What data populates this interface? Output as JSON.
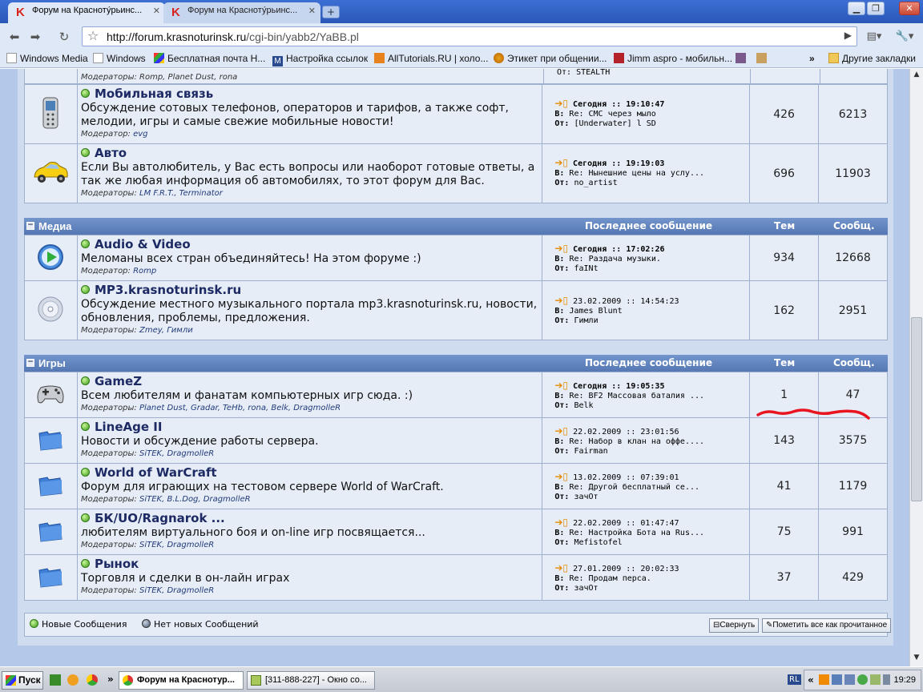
{
  "browser": {
    "tabs": [
      {
        "label": "Форум на Красноту́рьинс...",
        "active": true
      },
      {
        "label": "Форум на Красноту́рьинс...",
        "active": false
      }
    ],
    "new_tab": "+",
    "url_host": "http://forum.krasnoturinsk.ru",
    "url_path": "/cgi-bin/yabb2/YaBB.pl"
  },
  "bookmarks": [
    "Windows Media",
    "Windows",
    "Бесплатная почта Н...",
    "Настройка ссылок",
    "AllTutorials.RU | холо...",
    "Этикет при общении...",
    "Jimm aspro - мобильн...",
    "Другие закладки"
  ],
  "top_partial": {
    "mods": "Модераторы: Romp, Planet Dust, rona",
    "last_from": "От: STEALTH"
  },
  "sections": [
    {
      "rows": [
        {
          "name": "Мобильная связь",
          "desc": "Обсуждение сотовых телефонов, операторов и тарифов, а также софт, мелодии, игры и самые свежие мобильные новости!",
          "mods_label": "Модератор:",
          "mods": "evg",
          "last_date": "Сегодня :: 19:10:47",
          "last_in": "СМС через мыло",
          "last_from": "[Underwater] l SD",
          "topics": "426",
          "posts": "6213",
          "icon": "cellphone-icon"
        },
        {
          "name": "Авто",
          "desc": "Если Вы автолюбитель, у Вас есть вопросы или наоборот готовые ответы, а так же любая информация об автомобилях, то этот форум для Вас.",
          "mods_label": "Модераторы:",
          "mods": "LM F.R.T., Terminator",
          "last_date": "Сегодня :: 19:19:03",
          "last_in": "Нынешние цены на услу...",
          "last_from": "no_artist",
          "topics": "696",
          "posts": "11903",
          "icon": "car-icon"
        }
      ]
    },
    {
      "title": "Медиа",
      "head_last": "Последнее сообщение",
      "head_topics": "Тем",
      "head_posts": "Сообщ.",
      "rows": [
        {
          "name": "Audio & Video",
          "desc": "Меломаны всех стран объединяйтесь! На этом форуме :)",
          "mods_label": "Модератор:",
          "mods": "Romp",
          "last_date": "Сегодня :: 17:02:26",
          "last_in": "Раздача музыки.",
          "last_from": "faINt",
          "topics": "934",
          "posts": "12668",
          "icon": "play-icon"
        },
        {
          "name": "MP3.krasnoturinsk.ru",
          "desc": "Обсуждение местного музыкального портала mp3.krasnoturinsk.ru, новости, обновления, проблемы, предложения.",
          "mods_label": "Модераторы:",
          "mods": "Zmey, Гимли",
          "last_date": "23.02.2009 :: 14:54:23",
          "last_in": "James Blunt",
          "last_from": "Гимли",
          "topics": "162",
          "posts": "2951",
          "icon": "cd-icon"
        }
      ]
    },
    {
      "title": "Игры",
      "head_last": "Последнее сообщение",
      "head_topics": "Тем",
      "head_posts": "Сообщ.",
      "rows": [
        {
          "name": "GameZ",
          "desc": "Всем любителям и фанатам компьютерных игр сюда. :)",
          "mods_label": "Модераторы:",
          "mods": "Planet Dust, Gradar, TeHb, rona, Belk, DragmolleR",
          "last_date": "Сегодня :: 19:05:35",
          "last_in": "Re: BF2 Массовая баталия ...",
          "last_from": "Belk",
          "topics": "1",
          "posts": "47",
          "icon": "gamepad-icon"
        },
        {
          "name": "LineAge II",
          "desc": "Новости и обсуждение работы сервера.",
          "mods_label": "Модераторы:",
          "mods": "SiTEK, DragmolleR",
          "last_date": "22.02.2009 :: 23:01:56",
          "last_in": "Набор в клан на оффе....",
          "last_from": "Fairman",
          "topics": "143",
          "posts": "3575",
          "icon": "folder-icon"
        },
        {
          "name": "World of WarCraft",
          "desc": "Форум для играющих на тестовом сервере World of WarCraft.",
          "mods_label": "Модераторы:",
          "mods": "SiTEK, B.L.Dog, DragmolleR",
          "last_date": "13.02.2009 :: 07:39:01",
          "last_in": "Другой бесплатный се...",
          "last_from": "зачОт",
          "topics": "41",
          "posts": "1179",
          "icon": "folder-icon"
        },
        {
          "name": "БК/UO/Ragnarok ...",
          "desc": "любителям виртуального боя и on-line игр посвящается...",
          "mods_label": "Модераторы:",
          "mods": "SiTEK, DragmolleR",
          "last_date": "22.02.2009 :: 01:47:47",
          "last_in": "Настройка Бота на Rus...",
          "last_from": "Mefistofel",
          "topics": "75",
          "posts": "991",
          "icon": "folder-icon"
        },
        {
          "name": "Рынок",
          "desc": "Торговля и сделки в он-лайн играх",
          "mods_label": "Модераторы:",
          "mods": "SiTEK, DragmolleR",
          "last_date": "27.01.2009 :: 20:02:33",
          "last_in": "Продам перса.",
          "last_from": "зачОт",
          "topics": "37",
          "posts": "429",
          "icon": "folder-icon"
        }
      ]
    }
  ],
  "labels": {
    "in": "В:",
    "re": "Re:",
    "from": "От:"
  },
  "legend": {
    "new": "Новые Сообщения",
    "none": "Нет новых Сообщений",
    "collapse": "Свернуть",
    "mark_read": "Пометить все как прочитанное"
  },
  "taskbar": {
    "start": "Пуск",
    "task1": "Форум на Краснотур...",
    "task2": "[311-888-227] - Окно со...",
    "lang": "RL",
    "clock": "19:29"
  },
  "colors": {
    "accent": "#5577b3",
    "background": "#b4c9ea",
    "annotation": "#e8141f"
  }
}
